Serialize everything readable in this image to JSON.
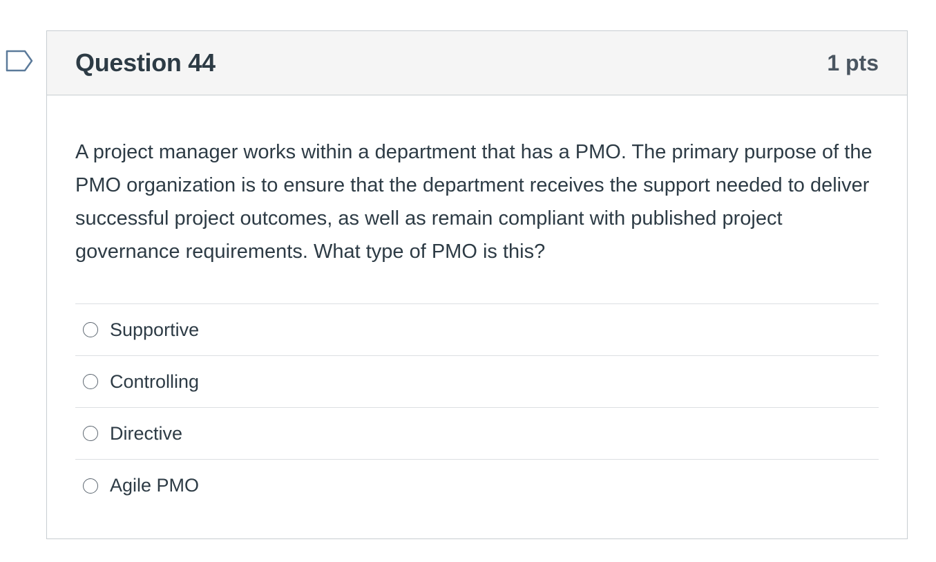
{
  "question": {
    "title": "Question 44",
    "points": "1 pts",
    "flag_icon": "flag-outline-icon",
    "text": "A project manager works within a department that has a PMO. The primary purpose of the PMO organization is to ensure that the department receives the support needed to deliver successful project outcomes, as well as remain compliant with published project governance requirements. What type of PMO is this?"
  },
  "answers": [
    {
      "label": "Supportive",
      "selected": false
    },
    {
      "label": "Controlling",
      "selected": false
    },
    {
      "label": "Directive",
      "selected": false
    },
    {
      "label": "Agile PMO",
      "selected": false
    }
  ],
  "colors": {
    "header_bg": "#f5f5f5",
    "border": "#c7cdd1",
    "text": "#2d3b45",
    "flag": "#5b7a9a"
  }
}
